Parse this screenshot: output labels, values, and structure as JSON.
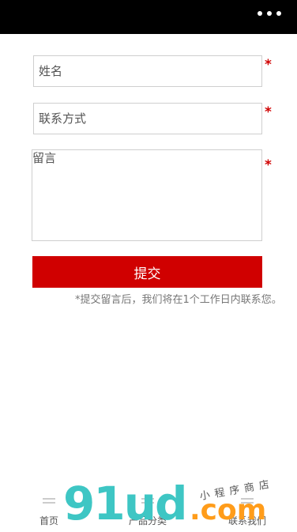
{
  "header": {
    "menu_icon": "more-dots-icon"
  },
  "form": {
    "name_placeholder": "姓名",
    "contact_placeholder": "联系方式",
    "message_placeholder": "留言",
    "required_mark": "*",
    "submit_label": "提交",
    "hint": "*提交留言后，我们将在1个工作日内联系您。"
  },
  "tabbar": {
    "items": [
      {
        "label": "首页",
        "icon": "menu-icon"
      },
      {
        "label": "产品分类",
        "icon": "menu-icon"
      },
      {
        "label": "联系我们",
        "icon": "menu-icon"
      }
    ]
  },
  "watermark": {
    "logo_main": "91ud",
    "logo_suffix": ".com",
    "tagline": "小程序商店"
  },
  "colors": {
    "accent": "#d00000",
    "topbar": "#000000",
    "logo_teal": "#3ec6c4",
    "logo_orange": "#ff9c1a"
  }
}
